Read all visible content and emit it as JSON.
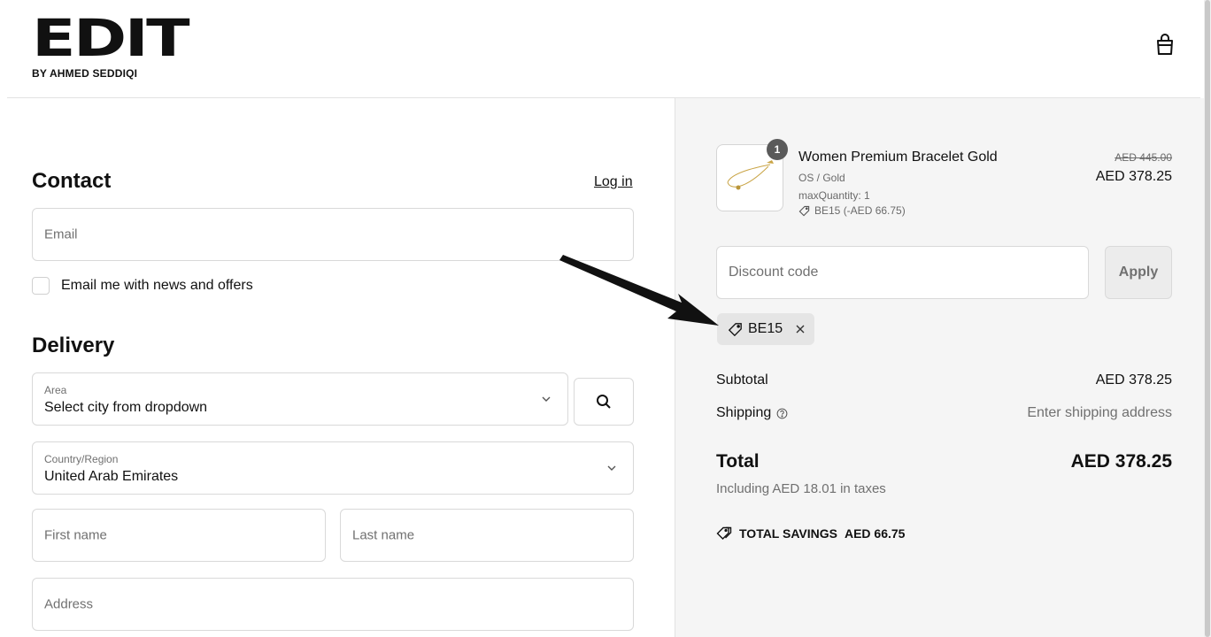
{
  "brand": {
    "logo_text": "EDIT",
    "logo_sub": "BY AHMED SEDDIQI"
  },
  "header": {
    "cart_icon": "shopping-bag-icon"
  },
  "contact": {
    "title": "Contact",
    "login_label": "Log in",
    "email_placeholder": "Email",
    "newsletter_label": "Email me with news and offers"
  },
  "delivery": {
    "title": "Delivery",
    "area": {
      "label": "Area",
      "value": "Select city from dropdown"
    },
    "country": {
      "label": "Country/Region",
      "value": "United Arab Emirates"
    },
    "first_name_placeholder": "First name",
    "last_name_placeholder": "Last name",
    "address_placeholder": "Address"
  },
  "summary": {
    "item": {
      "quantity": "1",
      "name": "Women Premium Bracelet Gold",
      "variant": "OS / Gold",
      "max_quantity": "maxQuantity: 1",
      "discount": "BE15 (-AED 66.75)",
      "price_original": "AED 445.00",
      "price_current": "AED 378.25"
    },
    "discount_placeholder": "Discount code",
    "apply_label": "Apply",
    "applied_code": "BE15",
    "subtotal_label": "Subtotal",
    "subtotal_value": "AED 378.25",
    "shipping_label": "Shipping",
    "shipping_value": "Enter shipping address",
    "total_label": "Total",
    "total_value": "AED 378.25",
    "taxes": "Including AED 18.01 in taxes",
    "savings_label": "TOTAL SAVINGS",
    "savings_value": "AED 66.75"
  },
  "colors": {
    "summary_bg": "#f5f5f5",
    "border": "#d9d9d9",
    "muted_text": "#707070",
    "badge": "#5a5a5a"
  }
}
